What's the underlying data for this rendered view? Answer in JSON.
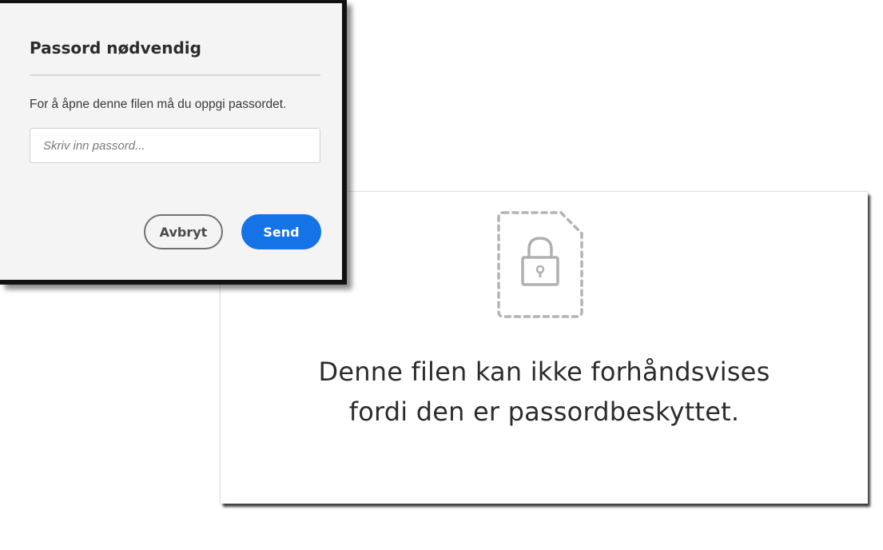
{
  "dialog": {
    "title": "Passord nødvendig",
    "message": "For å åpne denne filen må du oppgi passordet.",
    "password_placeholder": "Skriv inn passord...",
    "password_value": "",
    "cancel_label": "Avbryt",
    "send_label": "Send",
    "accent_color": "#1473e6"
  },
  "preview": {
    "icon": "locked-file-icon",
    "message_line1": "Denne filen kan ikke forhåndsvises",
    "message_line2": "fordi den er passordbeskyttet."
  }
}
